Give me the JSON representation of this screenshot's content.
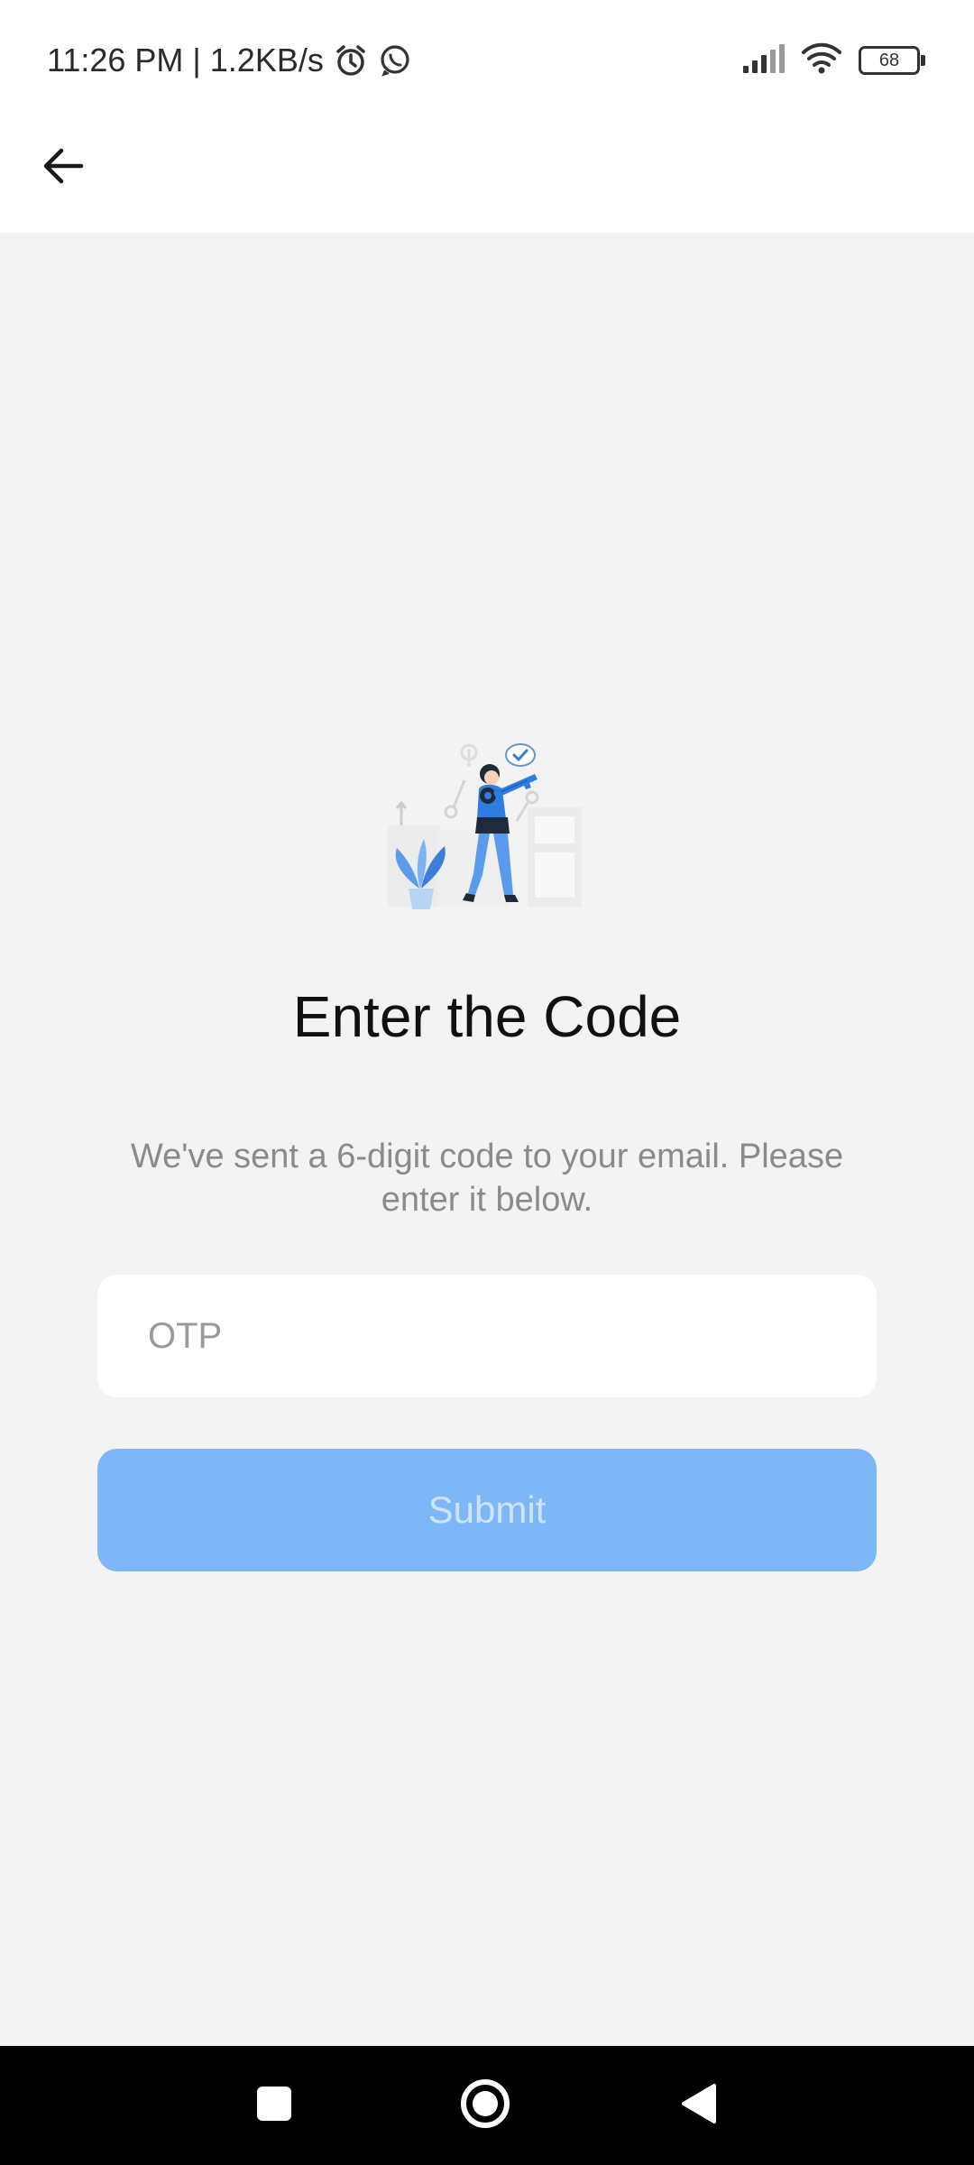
{
  "status_bar": {
    "time_and_speed": "11:26 PM | 1.2KB/s",
    "battery_level": "68",
    "icons": [
      "alarm-icon",
      "whatsapp-icon",
      "signal-icon",
      "wifi-icon",
      "battery-icon"
    ]
  },
  "app_bar": {
    "back_icon": "arrow-left-icon"
  },
  "main": {
    "illustration": "person-holding-key-illustration",
    "title": "Enter the Code",
    "subtitle": "We've sent a 6-digit code to your email. Please enter it below.",
    "otp_input": {
      "placeholder": "OTP",
      "value": ""
    },
    "submit_label": "Submit"
  },
  "nav_bar": {
    "icons": [
      "recents-square-icon",
      "home-circle-icon",
      "back-triangle-icon"
    ]
  },
  "colors": {
    "background": "#f3f3f3",
    "button_disabled": "#7db7f7",
    "button_text": "#cfe3fb",
    "accent_blue": "#2f7de1"
  }
}
